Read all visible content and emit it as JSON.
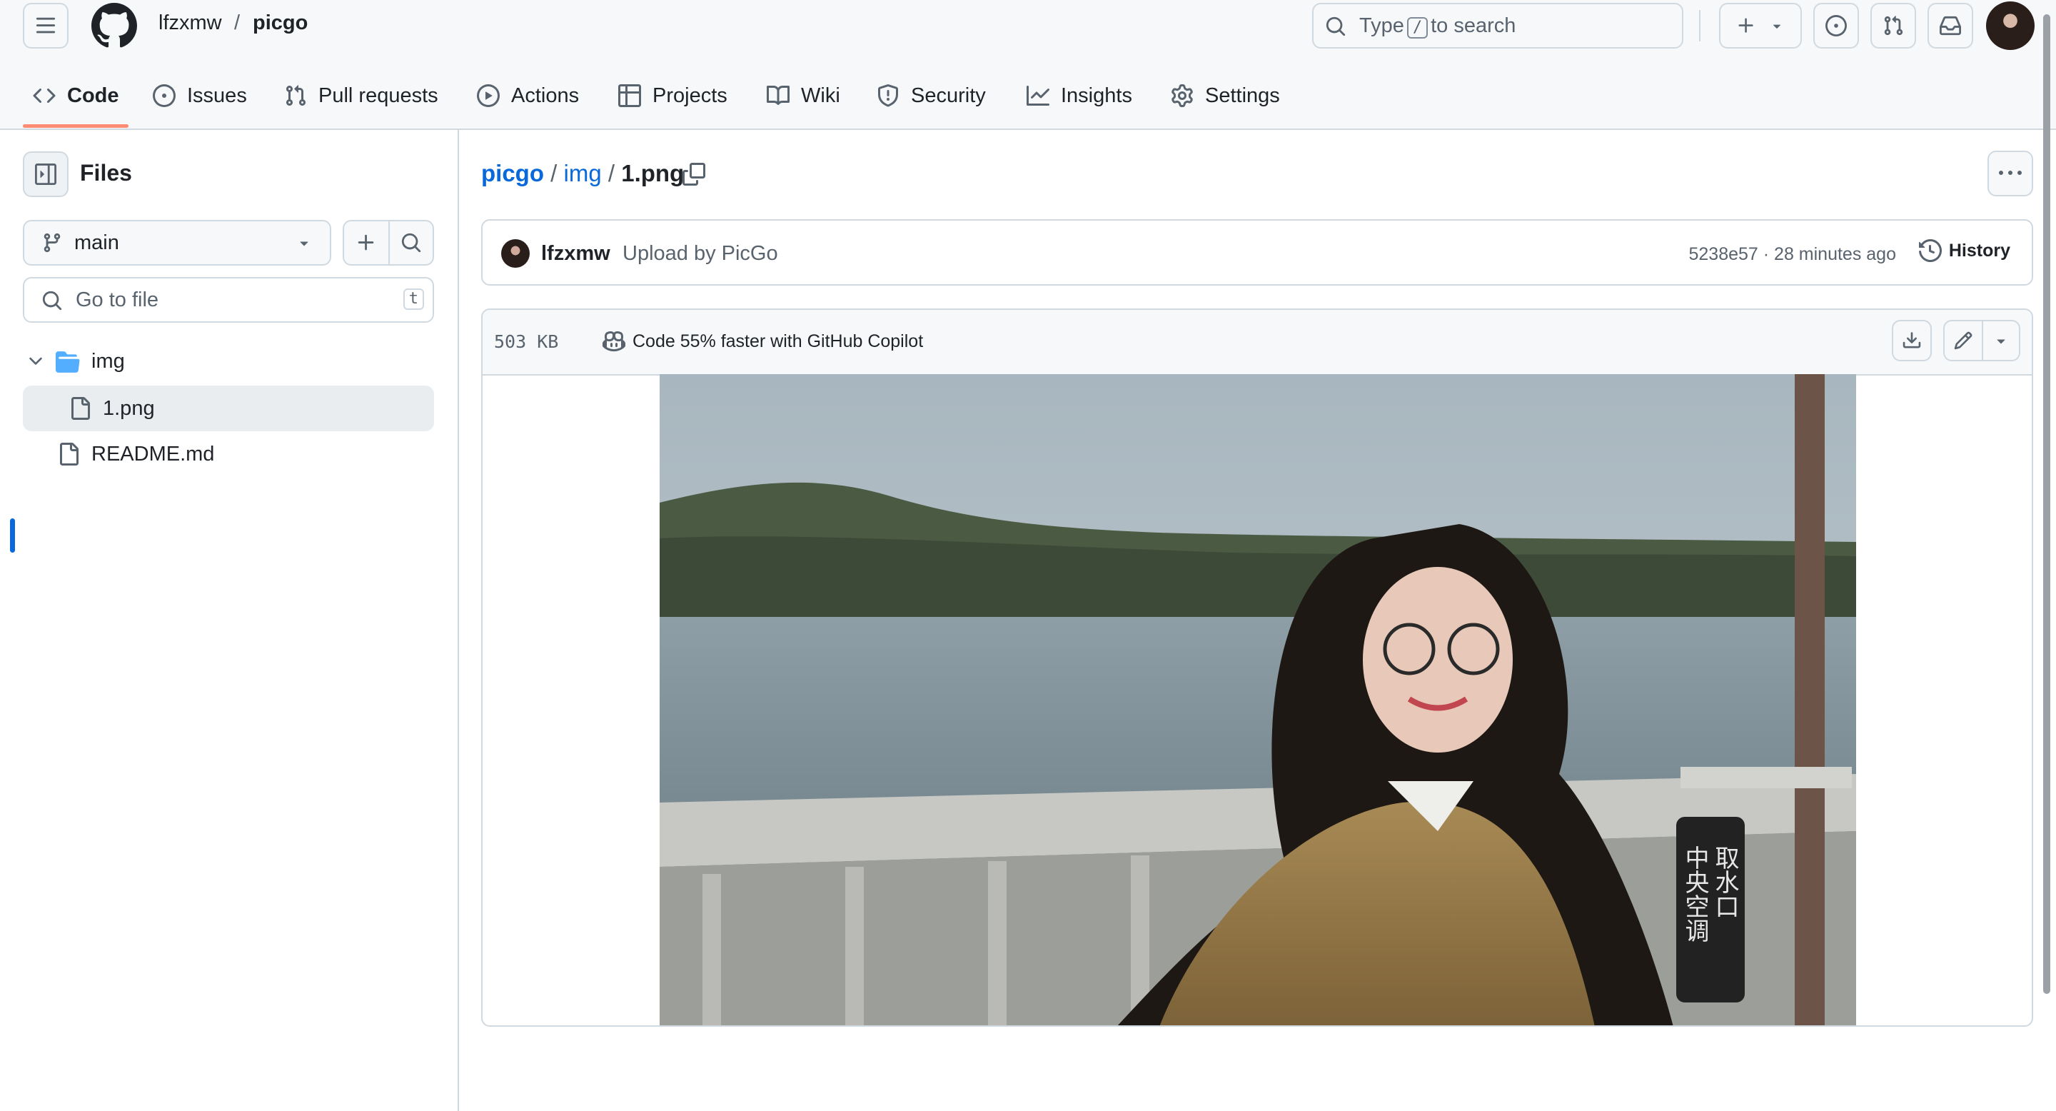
{
  "header": {
    "owner": "lfzxmw",
    "separator": "/",
    "repo": "picgo",
    "search": {
      "prefix": "Type",
      "key": "/",
      "suffix": "to search"
    }
  },
  "nav": {
    "tabs": [
      {
        "label": "Code",
        "icon": "code-icon",
        "selected": true
      },
      {
        "label": "Issues",
        "icon": "issue-opened-icon"
      },
      {
        "label": "Pull requests",
        "icon": "git-pull-request-icon"
      },
      {
        "label": "Actions",
        "icon": "play-icon"
      },
      {
        "label": "Projects",
        "icon": "table-icon"
      },
      {
        "label": "Wiki",
        "icon": "book-icon"
      },
      {
        "label": "Security",
        "icon": "shield-icon"
      },
      {
        "label": "Insights",
        "icon": "graph-icon"
      },
      {
        "label": "Settings",
        "icon": "gear-icon"
      }
    ]
  },
  "sidebar": {
    "title": "Files",
    "branch": "main",
    "goto_placeholder": "Go to file",
    "goto_key": "t",
    "tree": [
      {
        "name": "img",
        "type": "folder",
        "expanded": true
      },
      {
        "name": "1.png",
        "type": "file",
        "selected": true
      },
      {
        "name": "README.md",
        "type": "file"
      }
    ]
  },
  "main": {
    "path": {
      "repo": "picgo",
      "sep1": "/",
      "folder": "img",
      "sep2": "/",
      "file": "1.png"
    },
    "commit": {
      "author": "lfzxmw",
      "message": "Upload by PicGo",
      "meta": "5238e57 · 28 minutes ago",
      "history_label": "History"
    },
    "file": {
      "size": "503 KB",
      "copilot": "Code 55% faster with GitHub Copilot"
    },
    "image_sign": {
      "line1": "中央空调",
      "line2": "取水口"
    }
  },
  "colors": {
    "link": "#0969da",
    "accent_underline": "#fd8c73",
    "border": "#d1d9e0",
    "header_bg": "#f6f8fa"
  }
}
